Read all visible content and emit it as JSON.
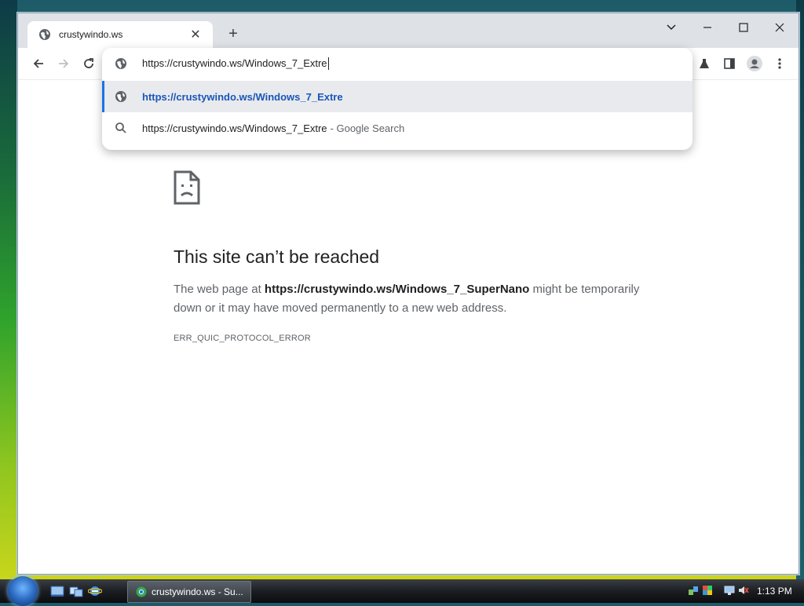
{
  "browser": {
    "tab": {
      "title": "crustywindo.ws"
    },
    "omnibox": {
      "input_value": "https://crustywindo.ws/Windows_7_Extre",
      "suggestions": [
        {
          "url": "https://crustywindo.ws/Windows_7_Extre",
          "suffix": ""
        },
        {
          "url": "https://crustywindo.ws/Windows_7_Extre",
          "suffix": "- Google Search"
        }
      ]
    }
  },
  "error": {
    "heading": "This site can’t be reached",
    "desc_prefix": "The web page at ",
    "desc_url": "https://crustywindo.ws/Windows_7_SuperNano",
    "desc_suffix": " might be temporarily down or it may have moved permanently to a new web address.",
    "code": "ERR_QUIC_PROTOCOL_ERROR"
  },
  "taskbar": {
    "task_label": "crustywindo.ws - Su...",
    "clock": "1:13 PM"
  },
  "colors": {
    "accent": "#1a73e8",
    "suggestion_selected_bg": "#e8eaed"
  }
}
